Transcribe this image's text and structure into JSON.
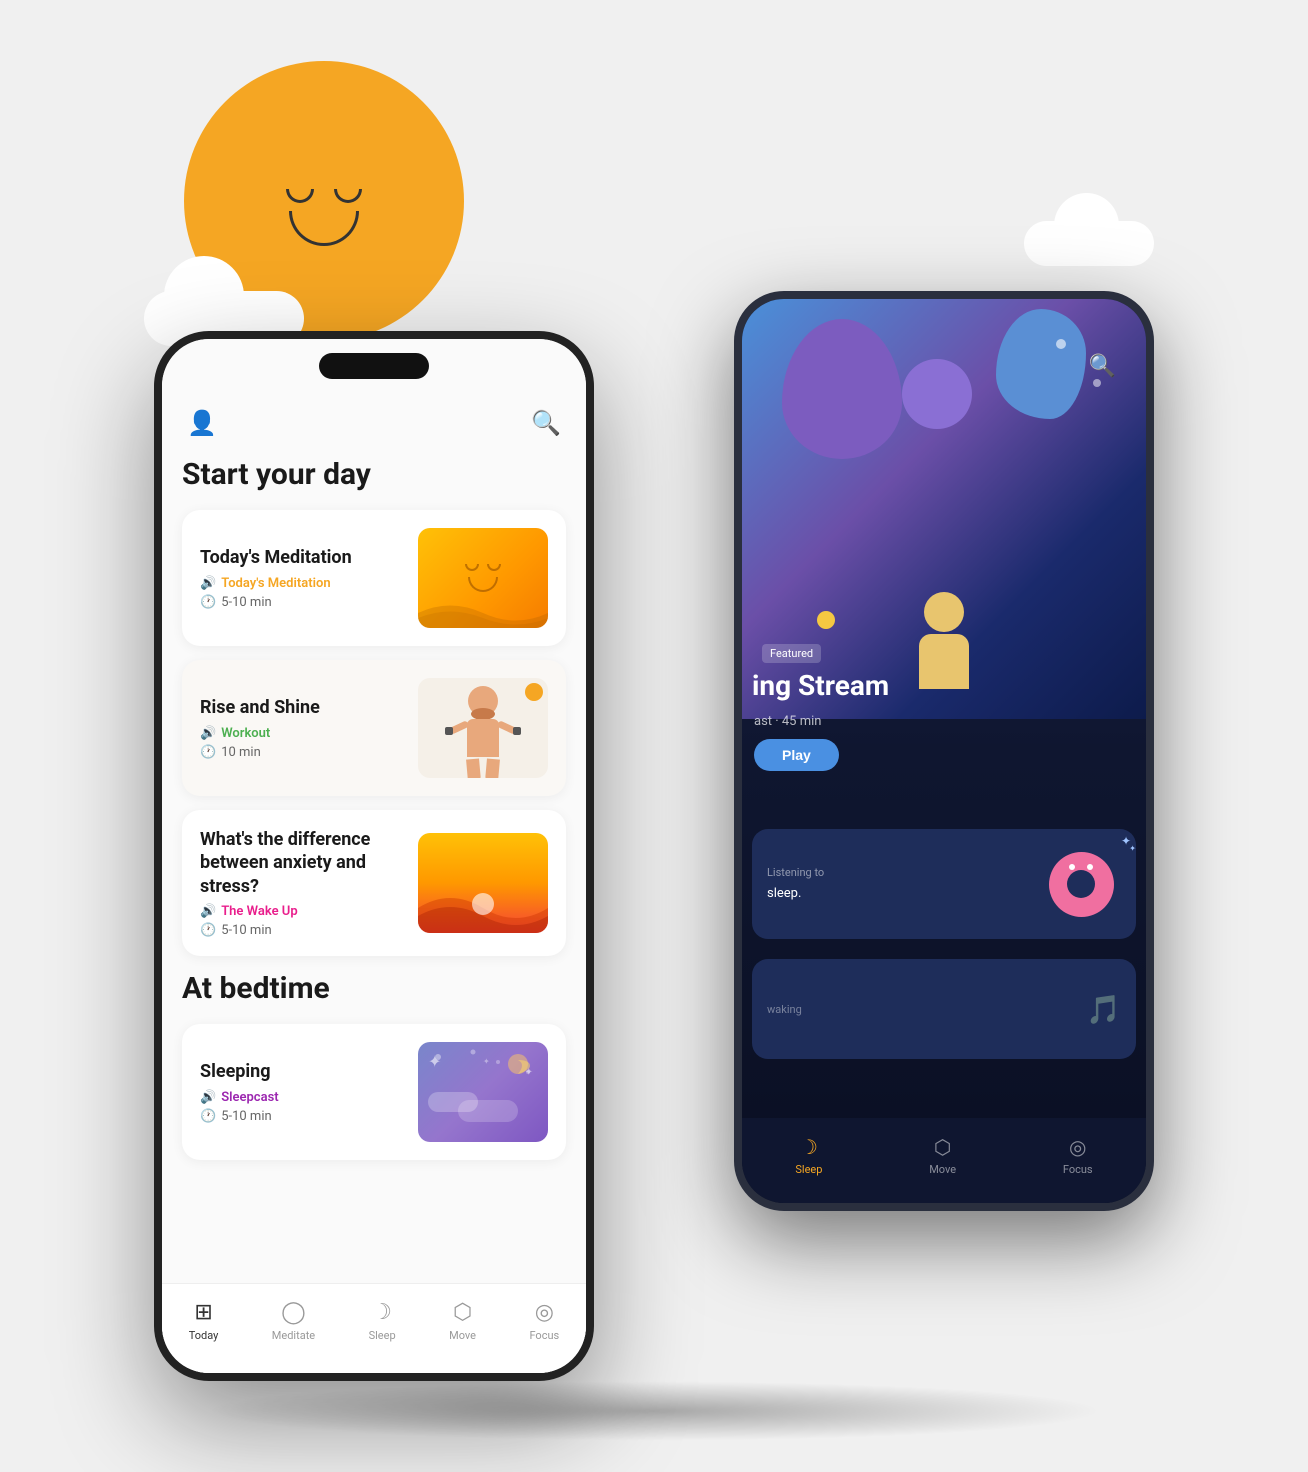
{
  "scene": {
    "background": "#f5f5f0"
  },
  "frontPhone": {
    "header": {
      "profile_icon": "👤",
      "search_icon": "🔍"
    },
    "sections": [
      {
        "title": "Start your day",
        "cards": [
          {
            "title": "Today's Meditation",
            "category": "Today's Meditation",
            "category_type": "meditation",
            "duration": "5-10 min",
            "image_type": "meditation"
          },
          {
            "title": "Rise and Shine",
            "category": "Workout",
            "category_type": "workout",
            "duration": "10 min",
            "image_type": "rise",
            "has_indicator": true
          },
          {
            "title": "What's the difference between anxiety and stress?",
            "category": "The Wake Up",
            "category_type": "wakeup",
            "duration": "5-10 min",
            "image_type": "anxiety"
          }
        ]
      },
      {
        "title": "At bedtime",
        "cards": [
          {
            "title": "Sleeping",
            "category": "Sleepcast",
            "category_type": "sleepcast",
            "duration": "5-10 min",
            "image_type": "sleeping"
          }
        ]
      }
    ],
    "bottomNav": [
      {
        "icon": "⊞",
        "label": "Today",
        "active": true
      },
      {
        "icon": "◯",
        "label": "Meditate",
        "active": false
      },
      {
        "icon": "☽",
        "label": "Sleep",
        "active": false
      },
      {
        "icon": "♢",
        "label": "Move",
        "active": false
      },
      {
        "icon": "◎",
        "label": "Focus",
        "active": false
      }
    ]
  },
  "backPhone": {
    "featured": {
      "label": "Featured",
      "title": "ing Stream",
      "subtitle": "ast · 45 min"
    },
    "play_button": "Play",
    "sleep_card": {
      "text": "ning to sleep.",
      "icon_type": "donut"
    },
    "music_card": {
      "text": "waking",
      "icon": "🎵"
    },
    "bottomNav": [
      {
        "icon": "☽",
        "label": "Sleep",
        "active": true
      },
      {
        "icon": "♢",
        "label": "Move",
        "active": false
      },
      {
        "icon": "◎",
        "label": "Focus",
        "active": false
      }
    ]
  }
}
